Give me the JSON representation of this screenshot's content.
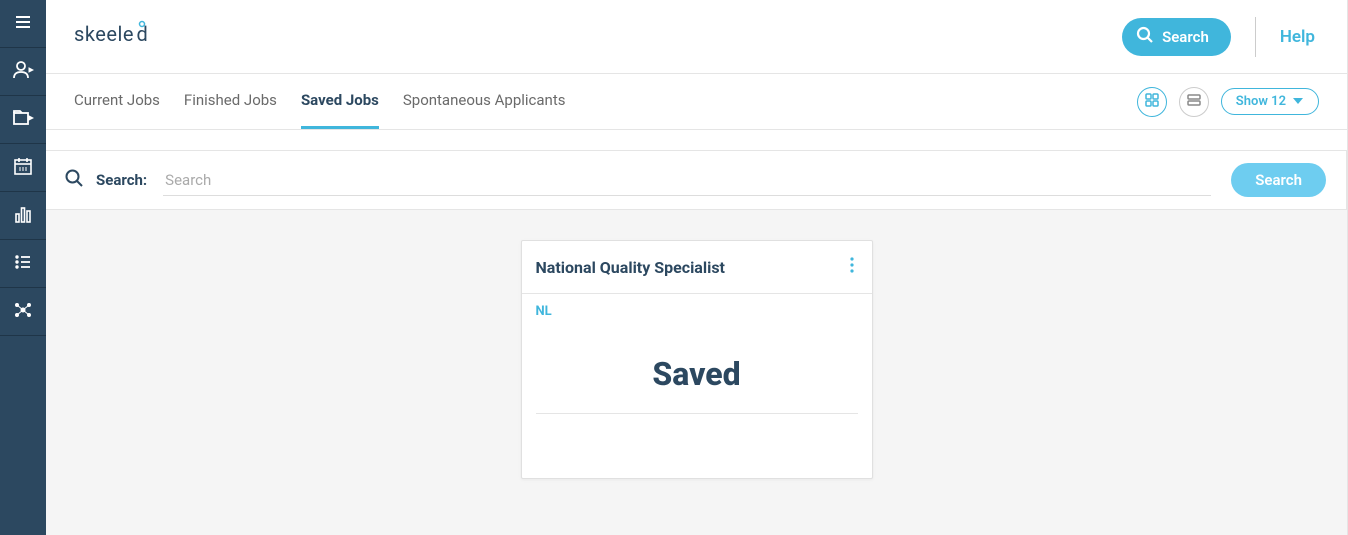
{
  "brand": "skeeled",
  "header": {
    "search_label": "Search",
    "help_label": "Help"
  },
  "tabs": {
    "current": "Current Jobs",
    "finished": "Finished Jobs",
    "saved": "Saved Jobs",
    "spontaneous": "Spontaneous Applicants"
  },
  "controls": {
    "show_label": "Show 12"
  },
  "search": {
    "label": "Search:",
    "placeholder": "Search",
    "button": "Search"
  },
  "card": {
    "title": "National Quality Specialist",
    "tag": "NL",
    "status": "Saved"
  }
}
